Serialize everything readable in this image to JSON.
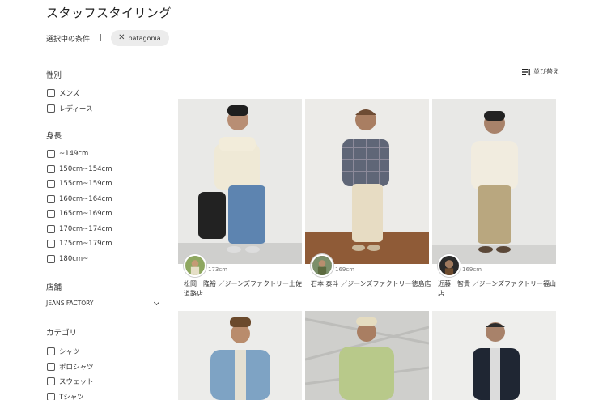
{
  "page": {
    "title": "スタッフスタイリング"
  },
  "conditions": {
    "label": "選択中の条件",
    "separator": "|",
    "chips": [
      {
        "label": "patagonia"
      }
    ]
  },
  "filters": {
    "gender": {
      "title": "性別",
      "options": [
        "メンズ",
        "レディース"
      ]
    },
    "height": {
      "title": "身長",
      "options": [
        "~149cm",
        "150cm~154cm",
        "155cm~159cm",
        "160cm~164cm",
        "165cm~169cm",
        "170cm~174cm",
        "175cm~179cm",
        "180cm~"
      ]
    },
    "store": {
      "title": "店舗",
      "selected": "JEANS FACTORY"
    },
    "category": {
      "title": "カテゴリ",
      "options": [
        "シャツ",
        "ポロシャツ",
        "スウェット",
        "Tシャツ"
      ]
    }
  },
  "sort": {
    "label": "並び替え"
  },
  "cards": [
    {
      "height": "173cm",
      "caption": "松岡　隆裕 ／ジーンズファクトリー土佐道路店"
    },
    {
      "height": "169cm",
      "caption": "石本 泰斗 ／ジーンズファクトリー徳島店"
    },
    {
      "height": "169cm",
      "caption": "近藤　智貴 ／ジーンズファクトリー福山店"
    },
    {
      "height": "",
      "caption": ""
    },
    {
      "height": "",
      "caption": ""
    },
    {
      "height": "",
      "caption": ""
    }
  ],
  "colors": {
    "chip_bg": "#ececec",
    "text": "#222222",
    "muted": "#777777"
  }
}
